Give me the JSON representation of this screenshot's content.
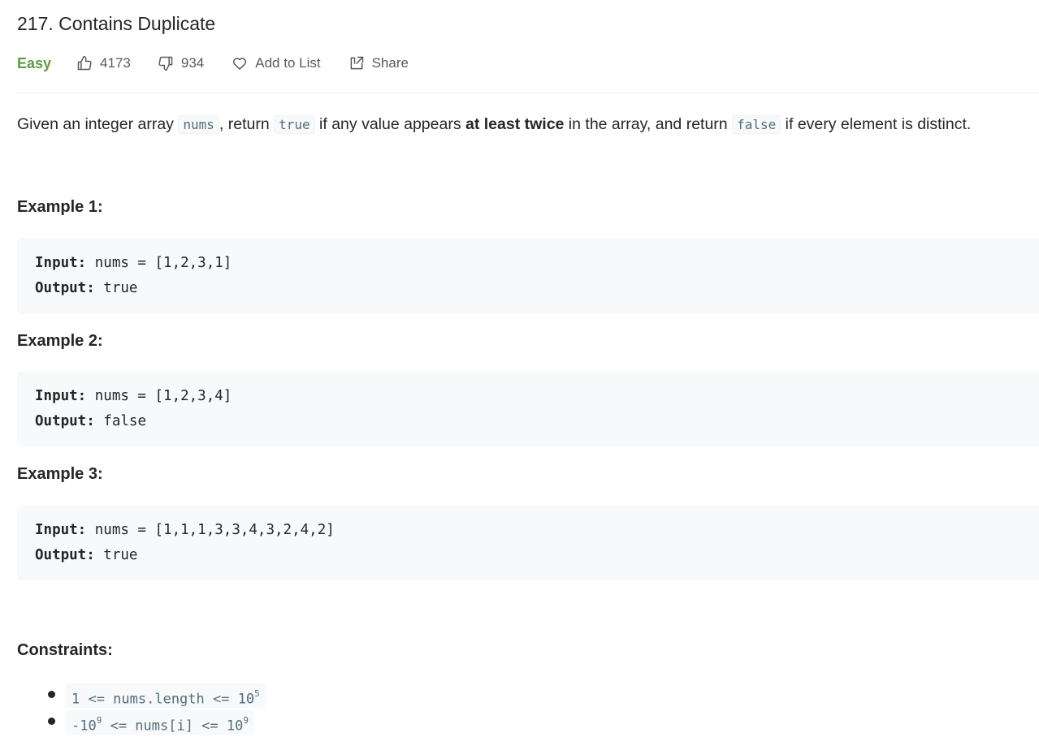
{
  "problem": {
    "title": "217. Contains Duplicate",
    "difficulty": "Easy",
    "likes": "4173",
    "dislikes": "934",
    "add_to_list": "Add to List",
    "share": "Share"
  },
  "description": {
    "p1": "Given an integer array ",
    "c1": "nums",
    "p2": ", return ",
    "c2": "true",
    "p3": " if any value appears ",
    "bold": "at least twice",
    "p4": " in the array, and return ",
    "c3": "false",
    "p5": " if every element is distinct."
  },
  "examples": [
    {
      "title": "Example 1:",
      "input_label": "Input:",
      "input_value": " nums = [1,2,3,1]",
      "output_label": "Output:",
      "output_value": " true"
    },
    {
      "title": "Example 2:",
      "input_label": "Input:",
      "input_value": " nums = [1,2,3,4]",
      "output_label": "Output:",
      "output_value": " false"
    },
    {
      "title": "Example 3:",
      "input_label": "Input:",
      "input_value": " nums = [1,1,1,3,3,4,3,2,4,2]",
      "output_label": "Output:",
      "output_value": " true"
    }
  ],
  "constraints": {
    "title": "Constraints:",
    "c1_text": "1 <= nums.length <= 10",
    "c1_sup": "5",
    "c2_a": "-10",
    "c2_sup_a": "9",
    "c2_b": " <= nums[i] <= 10",
    "c2_sup_b": "9"
  },
  "icons": {
    "like": "thumbs-up-icon",
    "dislike": "thumbs-down-icon",
    "heart": "heart-icon",
    "share": "share-icon"
  },
  "colors": {
    "difficulty_easy": "#5d9c45",
    "code_bg": "#f7f9fa",
    "code_text": "#546e7a"
  }
}
